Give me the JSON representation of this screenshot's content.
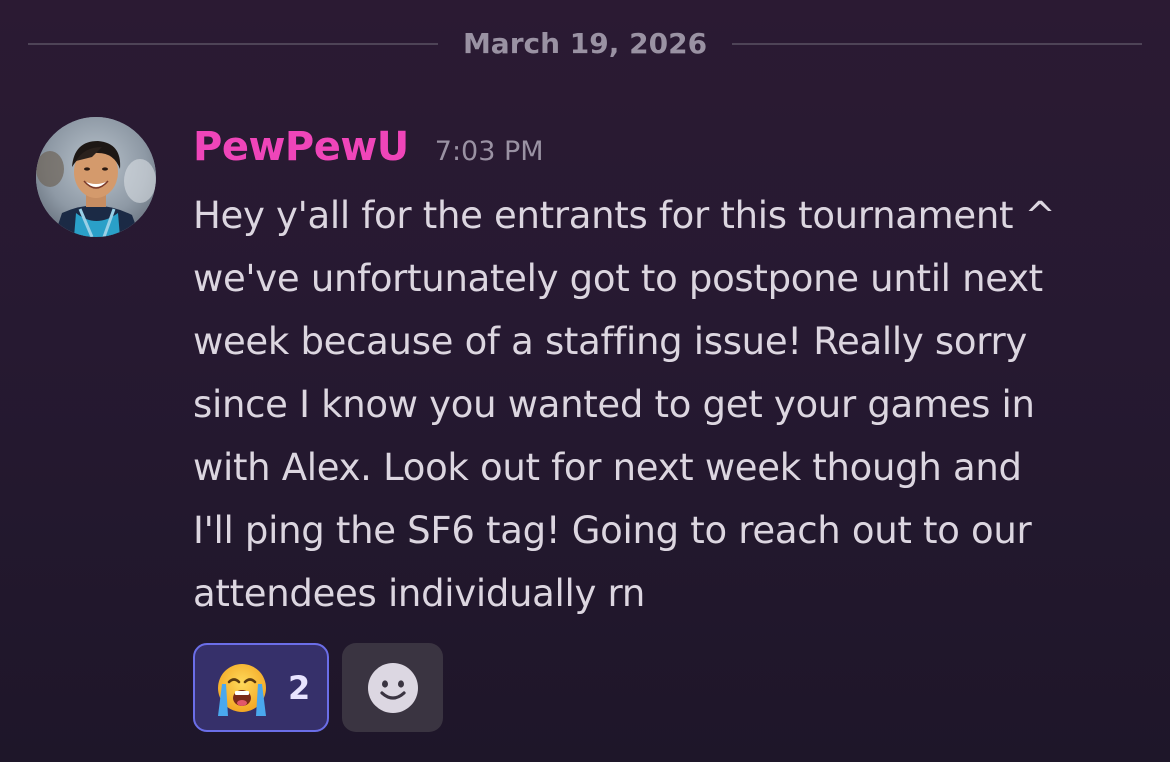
{
  "date_divider": {
    "label": "March 19, 2026"
  },
  "message": {
    "author": "PewPewU",
    "author_color": "#ef45b9",
    "timestamp": "7:03 PM",
    "avatar_icon": "user-avatar-photo",
    "lines": [
      "Hey y'all for the entrants for this tournament ^",
      "we've unfortunately got to postpone until next",
      "week because of a staffing issue! Really sorry",
      "since I know you wanted to get your games in",
      "with Alex. Look out for next week though and",
      "I'll ping the SF6 tag! Going to reach out to our",
      "attendees individually rn"
    ]
  },
  "reactions": [
    {
      "emoji": "loudly-crying-face-icon",
      "count": "2",
      "selected": true,
      "accent": "#6b6ee8"
    }
  ],
  "add_reaction": {
    "icon": "smiley-add-reaction-icon"
  }
}
